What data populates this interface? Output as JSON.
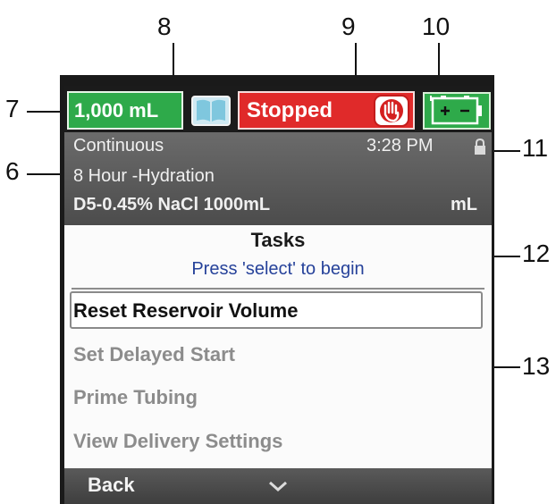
{
  "callouts": {
    "n6": "6",
    "n7": "7",
    "n8": "8",
    "n9": "9",
    "n10": "10",
    "n11": "11",
    "n12": "12",
    "n13": "13"
  },
  "status_bar": {
    "volume": "1,000 mL",
    "state": "Stopped",
    "icons": [
      "book-icon",
      "hand-stop-icon",
      "battery-icon"
    ],
    "colors": {
      "volume_bg": "#2eaa4a",
      "state_bg": "#e02a2a",
      "battery_bg": "#2eaa4a"
    }
  },
  "info": {
    "mode": "Continuous",
    "time": "3:28 PM",
    "protocol": "8 Hour -Hydration",
    "drug": "D5-0.45% NaCl 1000mL",
    "unit": "mL",
    "lock_icon": "lock-icon"
  },
  "tasks": {
    "title": "Tasks",
    "subtitle": "Press 'select' to begin",
    "items": [
      {
        "label": "Reset Reservoir Volume",
        "selected": true
      },
      {
        "label": "Set Delayed Start",
        "selected": false
      },
      {
        "label": "Prime Tubing",
        "selected": false
      },
      {
        "label": "View Delivery Settings",
        "selected": false
      }
    ]
  },
  "softkeys": {
    "left": "Back",
    "scroll_icon": "chevron-down-icon"
  }
}
